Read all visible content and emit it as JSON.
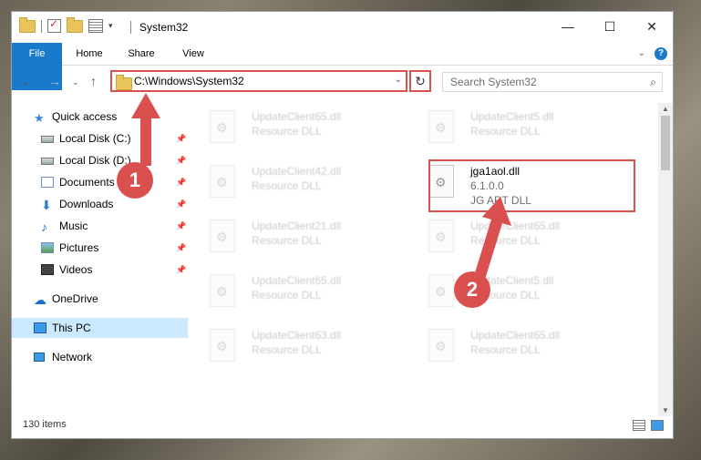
{
  "window": {
    "title": "System32"
  },
  "ribbon": {
    "tabs": [
      "File",
      "Home",
      "Share",
      "View"
    ]
  },
  "navigation": {
    "address": "C:\\Windows\\System32",
    "search_placeholder": "Search System32"
  },
  "sidebar": {
    "items": [
      {
        "label": "Quick access",
        "icon": "star-icon",
        "pinned": false,
        "selected": false
      },
      {
        "label": "Local Disk (C:)",
        "icon": "disk-icon",
        "pinned": true,
        "selected": false
      },
      {
        "label": "Local Disk (D:)",
        "icon": "disk-icon",
        "pinned": true,
        "selected": false
      },
      {
        "label": "Documents",
        "icon": "documents-icon",
        "pinned": true,
        "selected": false
      },
      {
        "label": "Downloads",
        "icon": "download-icon",
        "pinned": true,
        "selected": false
      },
      {
        "label": "Music",
        "icon": "music-icon",
        "pinned": true,
        "selected": false
      },
      {
        "label": "Pictures",
        "icon": "pictures-icon",
        "pinned": true,
        "selected": false
      },
      {
        "label": "Videos",
        "icon": "video-icon",
        "pinned": true,
        "selected": false
      },
      {
        "label": "OneDrive",
        "icon": "cloud-icon",
        "pinned": false,
        "selected": false
      },
      {
        "label": "This PC",
        "icon": "pc-icon",
        "pinned": false,
        "selected": true
      },
      {
        "label": "Network",
        "icon": "network-icon",
        "pinned": false,
        "selected": false
      }
    ]
  },
  "files": [
    {
      "name": "UpdateClient65.dll",
      "desc": "Resource DLL",
      "blurred": true
    },
    {
      "name": "UpdateClient5.dll",
      "desc": "Resource DLL",
      "blurred": true
    },
    {
      "name": "UpdateClient42.dll",
      "desc": "Resource DLL",
      "blurred": true
    },
    {
      "name": "jga1aol.dll",
      "version": "6.1.0.0",
      "desc": "JG ART DLL",
      "blurred": false
    },
    {
      "name": "UpdateClient21.dll",
      "desc": "Resource DLL",
      "blurred": true
    },
    {
      "name": "UpdateClient65.dll",
      "desc": "Resource DLL",
      "blurred": true
    },
    {
      "name": "UpdateClient65.dll",
      "desc": "Resource DLL",
      "blurred": true
    },
    {
      "name": "UpdateClient5.dll",
      "desc": "Resource DLL",
      "blurred": true
    },
    {
      "name": "UpdateClient63.dll",
      "desc": "Resource DLL",
      "blurred": true
    },
    {
      "name": "UpdateClient65.dll",
      "desc": "Resource DLL",
      "blurred": true
    }
  ],
  "status": {
    "item_count": "130 items"
  },
  "annotations": {
    "step1": "1",
    "step2": "2",
    "color": "#d9504f"
  }
}
